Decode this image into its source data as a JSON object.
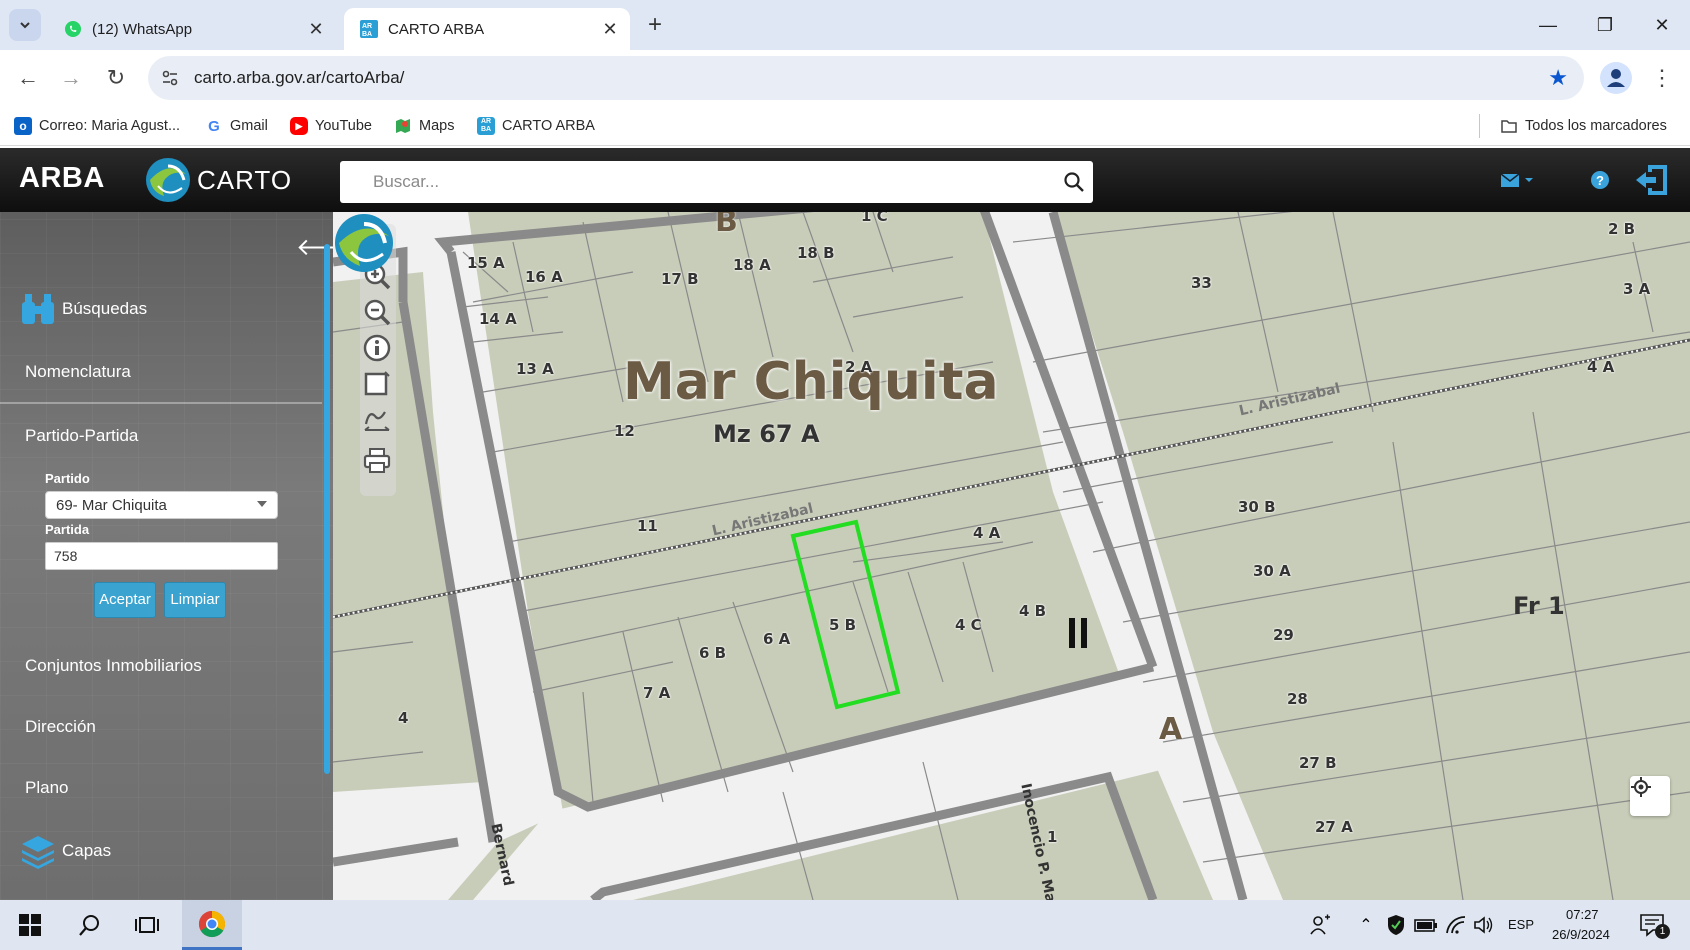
{
  "browser": {
    "tabs": [
      {
        "label": "(12) WhatsApp",
        "active": false,
        "icon": "whatsapp-icon"
      },
      {
        "label": "CARTO ARBA",
        "active": true,
        "icon": "arba-favicon"
      }
    ],
    "url": "carto.arba.gov.ar/cartoArba/",
    "bookmarks": [
      {
        "label": "Correo: Maria Agust...",
        "icon": "outlook-icon"
      },
      {
        "label": "Gmail",
        "icon": "google-icon"
      },
      {
        "label": "YouTube",
        "icon": "youtube-icon"
      },
      {
        "label": "Maps",
        "icon": "maps-icon"
      },
      {
        "label": "CARTO ARBA",
        "icon": "arba-favicon"
      }
    ],
    "all_bookmarks": "Todos los marcadores"
  },
  "header": {
    "logo": "ARBA",
    "carto": "CARTO",
    "search_placeholder": "Buscar..."
  },
  "sidebar": {
    "busquedas": "Búsquedas",
    "nomenclatura": "Nomenclatura",
    "partido_partida": "Partido-Partida",
    "partido_label": "Partido",
    "partido_value": "69- Mar Chiquita",
    "partida_label": "Partida",
    "partida_value": "758",
    "aceptar": "Aceptar",
    "limpiar": "Limpiar",
    "conjuntos": "Conjuntos Inmobiliarios",
    "direccion": "Dirección",
    "plano": "Plano",
    "capas": "Capas"
  },
  "map": {
    "locality": "Mar Chiquita",
    "manzana": "Mz 67 A",
    "streets": [
      "L. Aristizabal",
      "L. Aristizabal",
      "Inocencio P. Mari",
      "Bernard"
    ],
    "block_letters": [
      "B",
      "A"
    ],
    "fraction": "Fr 1",
    "parcels": [
      "15 A",
      "16 A",
      "17 B",
      "18 A",
      "18 B",
      "1 C",
      "14 A",
      "13 A",
      "2 A",
      "12",
      "11",
      "4 A",
      "4 B",
      "4 C",
      "5 B",
      "6 A",
      "6 B",
      "7 A",
      "4",
      "1",
      "33",
      "2 B",
      "3 A",
      "4 A",
      "30 B",
      "30 A",
      "29",
      "28",
      "27 B",
      "27 A"
    ],
    "highlight_color": "#22dd22"
  },
  "taskbar": {
    "language": "ESP",
    "time": "07:27",
    "date": "26/9/2024",
    "notifications": "1"
  }
}
